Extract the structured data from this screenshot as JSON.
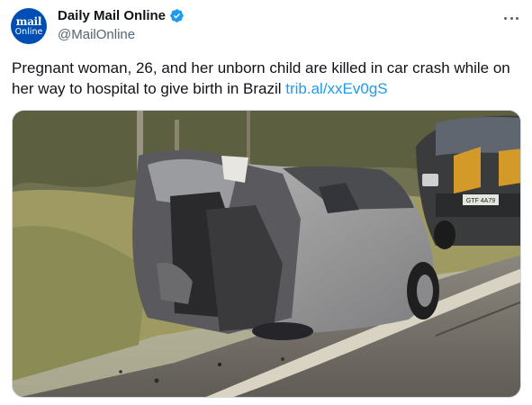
{
  "account": {
    "display_name": "Daily Mail Online",
    "handle": "@MailOnline",
    "avatar_line1": "mail",
    "avatar_line2": "Online",
    "verified_color": "#1d9bf0"
  },
  "tweet": {
    "text": "Pregnant woman, 26, and her unborn child are killed in car crash while on her way to hospital to give birth in Brazil ",
    "link_text": "trib.al/xxEv0gS"
  },
  "media": {
    "license_plate": "GTF 4A79"
  },
  "icons": {
    "more": "more-options-icon",
    "verified": "verified-badge-icon"
  },
  "colors": {
    "link": "#1d9bf0",
    "avatar_bg": "#004db3",
    "secondary_text": "#536471"
  }
}
